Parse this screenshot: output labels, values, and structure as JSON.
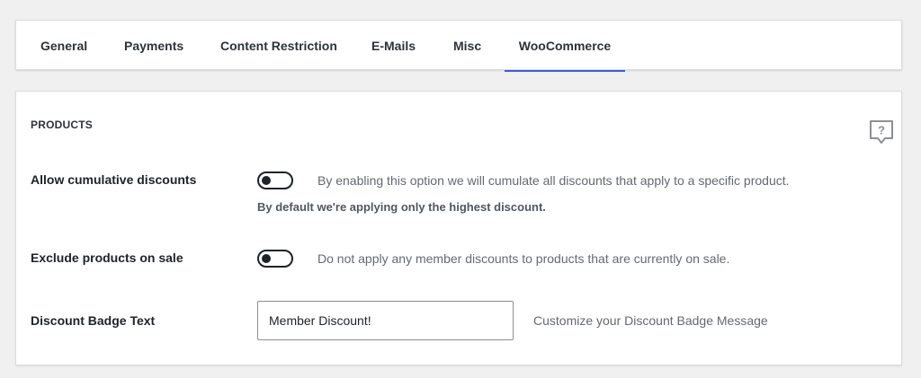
{
  "tabs": [
    {
      "label": "General",
      "active": false
    },
    {
      "label": "Payments",
      "active": false
    },
    {
      "label": "Content Restriction",
      "active": false
    },
    {
      "label": "E-Mails",
      "active": false
    },
    {
      "label": "Misc",
      "active": false
    },
    {
      "label": "WooCommerce",
      "active": true
    }
  ],
  "section": {
    "title": "PRODUCTS",
    "help_icon": "help-question-icon"
  },
  "settings": {
    "cumulative": {
      "label": "Allow cumulative discounts",
      "enabled": false,
      "description": "By enabling this option we will cumulate all discounts that apply to a specific product.",
      "note": "By default we're applying only the highest discount."
    },
    "exclude_sale": {
      "label": "Exclude products on sale",
      "enabled": false,
      "description": "Do not apply any member discounts to products that are currently on sale."
    },
    "badge_text": {
      "label": "Discount Badge Text",
      "value": "Member Discount!",
      "description": "Customize your Discount Badge Message"
    }
  },
  "colors": {
    "accent": "#3d5bd9",
    "background": "#f0f0f1"
  }
}
